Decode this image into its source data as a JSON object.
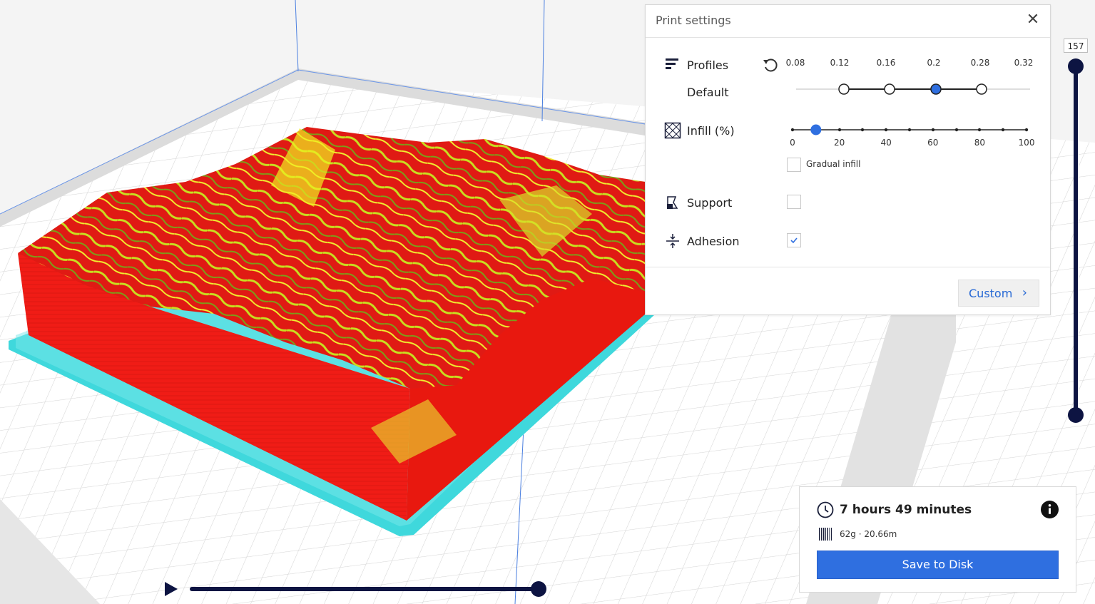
{
  "print_settings": {
    "title": "Print settings",
    "close_icon": "close-icon",
    "profiles": {
      "label": "Profiles",
      "sublabel": "Default",
      "layer_heights": [
        "0.08",
        "0.12",
        "0.16",
        "0.2",
        "0.28",
        "0.32"
      ],
      "selected": "0.2"
    },
    "infill": {
      "label": "Infill (%)",
      "ticks": [
        "0",
        "20",
        "40",
        "60",
        "80",
        "100"
      ],
      "value_percent": 10,
      "gradual_label": "Gradual infill",
      "gradual_checked": false
    },
    "support": {
      "label": "Support",
      "checked": false
    },
    "adhesion": {
      "label": "Adhesion",
      "checked": true
    },
    "custom_label": "Custom"
  },
  "layer_slider": {
    "value": "157"
  },
  "estimate": {
    "time": "7 hours 49 minutes",
    "material": "62g · 20.66m",
    "save_label": "Save to Disk"
  },
  "colors": {
    "accent": "#2f6fe0",
    "model_red": "#f01c16",
    "model_yellow": "#e8f020",
    "brim_cyan": "#3fd8dc",
    "slider_dark": "#0d1442"
  }
}
